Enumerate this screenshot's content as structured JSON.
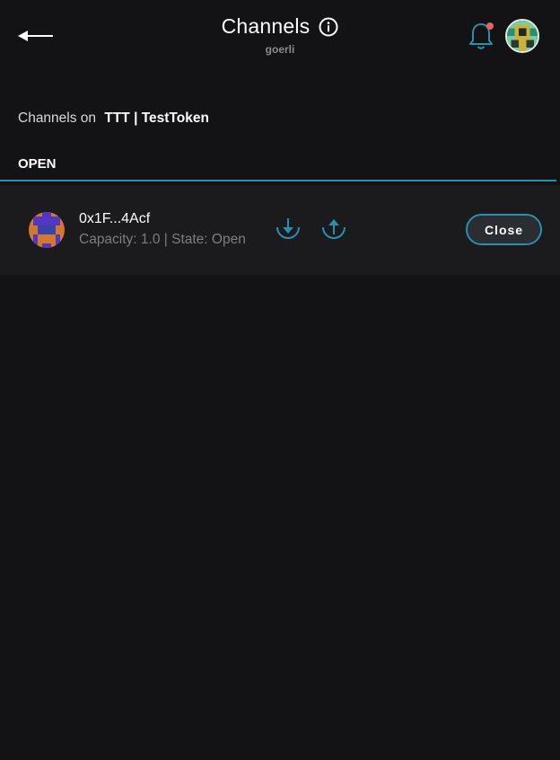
{
  "header": {
    "title": "Channels",
    "network": "goerli"
  },
  "subtitle": {
    "prefix": "Channels on",
    "token": "TTT | TestToken"
  },
  "tabs": [
    {
      "label": "OPEN"
    }
  ],
  "channels": [
    {
      "address": "0x1F...4Acf",
      "info": "Capacity: 1.0 | State: Open",
      "close_label": "Close"
    }
  ],
  "colors": {
    "background": "#131315",
    "row_background": "#1b1b1d",
    "accent": "#2a8fae",
    "notification_dot": "#e8645a"
  },
  "icons": {
    "back": "arrow-left-icon",
    "info": "info-circle-icon",
    "notifications": "bell-icon",
    "fund": "download-icon",
    "withdraw": "upload-icon"
  }
}
